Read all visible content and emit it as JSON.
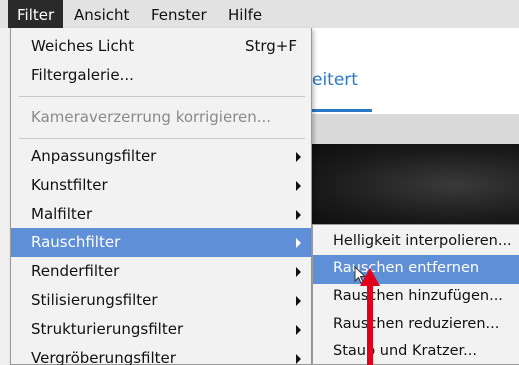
{
  "menubar": {
    "items": [
      "Filter",
      "Ansicht",
      "Fenster",
      "Hilfe"
    ]
  },
  "background": {
    "tab_label": "eitert"
  },
  "filter_menu": {
    "items": [
      {
        "label": "Weiches Licht",
        "shortcut": "Strg+F"
      },
      {
        "label": "Filtergalerie..."
      },
      {
        "label": "Kameraverzerrung korrigieren..."
      },
      {
        "label": "Anpassungsfilter"
      },
      {
        "label": "Kunstfilter"
      },
      {
        "label": "Malfilter"
      },
      {
        "label": "Rauschfilter"
      },
      {
        "label": "Renderfilter"
      },
      {
        "label": "Stilisierungsfilter"
      },
      {
        "label": "Strukturierungsfilter"
      },
      {
        "label": "Vergröberungsfilter"
      }
    ]
  },
  "rauschfilter_submenu": {
    "items": [
      {
        "label": "Helligkeit interpolieren..."
      },
      {
        "label": "Rauschen entfernen"
      },
      {
        "label": "Rauschen hinzufügen..."
      },
      {
        "label": "Rauschen reduzieren..."
      },
      {
        "label": "Staub und Kratzer..."
      }
    ]
  },
  "colors": {
    "highlight": "#5f8fd6",
    "annotation_arrow": "#e0001b",
    "accent_tab": "#2a78c8"
  },
  "icons": {
    "submenu_arrow": "chevron-right-icon",
    "cursor": "mouse-pointer-icon",
    "annotation": "red-arrow-icon"
  }
}
